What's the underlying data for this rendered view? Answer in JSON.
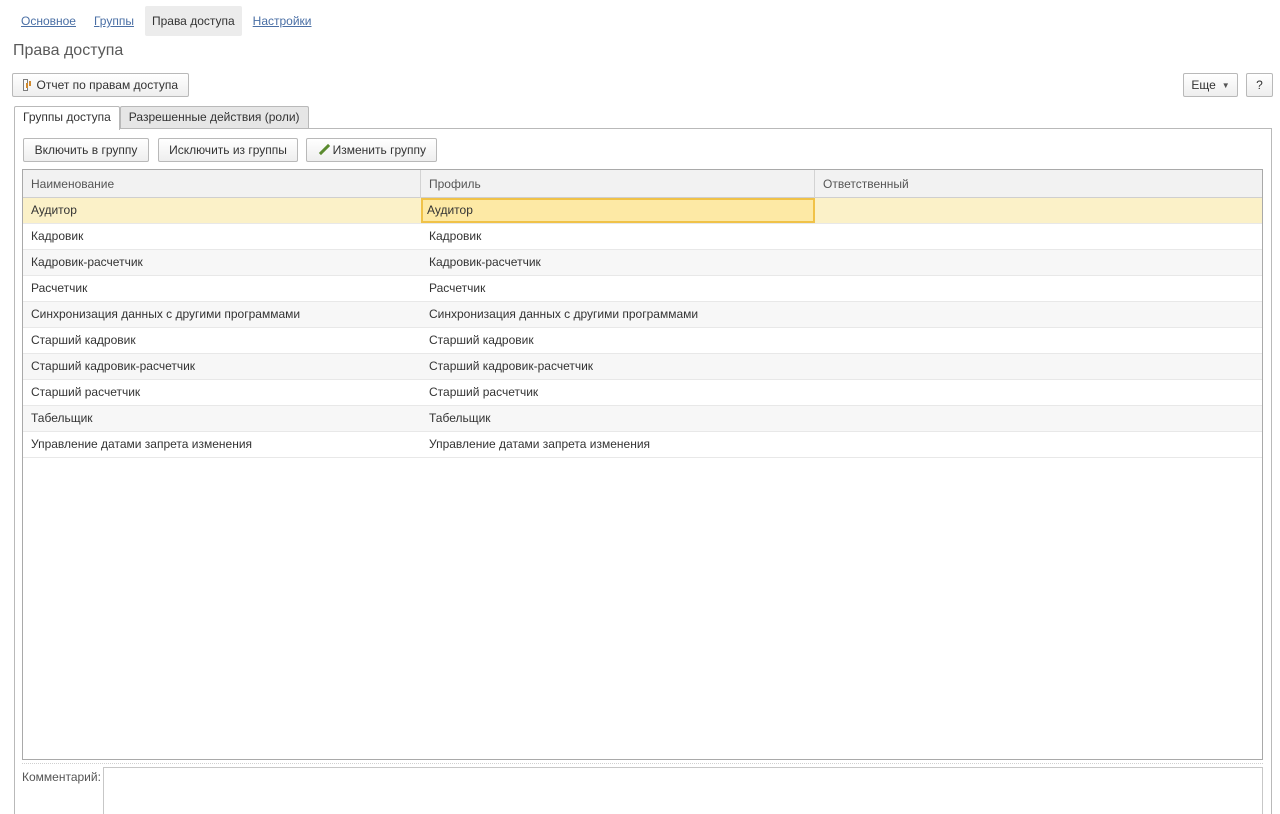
{
  "nav": {
    "items": [
      {
        "label": "Основное"
      },
      {
        "label": "Группы"
      },
      {
        "label": "Права доступа"
      },
      {
        "label": "Настройки"
      }
    ]
  },
  "page": {
    "title": "Права доступа"
  },
  "toolbar": {
    "report_label": "Отчет по правам доступа",
    "more_label": "Еще",
    "help_label": "?"
  },
  "tabs": [
    {
      "label": "Группы доступа"
    },
    {
      "label": "Разрешенные действия (роли)"
    }
  ],
  "actions": {
    "include_label": "Включить в группу",
    "exclude_label": "Исключить из группы",
    "edit_label": "Изменить группу"
  },
  "table": {
    "columns": [
      "Наименование",
      "Профиль",
      "Ответственный"
    ],
    "rows": [
      {
        "name": "Аудитор",
        "profile": "Аудитор",
        "responsible": ""
      },
      {
        "name": "Кадровик",
        "profile": "Кадровик",
        "responsible": ""
      },
      {
        "name": "Кадровик-расчетчик",
        "profile": "Кадровик-расчетчик",
        "responsible": ""
      },
      {
        "name": "Расчетчик",
        "profile": "Расчетчик",
        "responsible": ""
      },
      {
        "name": "Синхронизация данных с другими программами",
        "profile": "Синхронизация данных с другими программами",
        "responsible": ""
      },
      {
        "name": "Старший кадровик",
        "profile": "Старший кадровик",
        "responsible": ""
      },
      {
        "name": "Старший кадровик-расчетчик",
        "profile": "Старший кадровик-расчетчик",
        "responsible": ""
      },
      {
        "name": "Старший расчетчик",
        "profile": "Старший расчетчик",
        "responsible": ""
      },
      {
        "name": "Табельщик",
        "profile": "Табельщик",
        "responsible": ""
      },
      {
        "name": "Управление датами запрета изменения",
        "profile": "Управление датами запрета изменения",
        "responsible": ""
      }
    ]
  },
  "comment": {
    "label": "Комментарий:",
    "value": ""
  },
  "colors": {
    "link": "#4a6fa5",
    "selection": "#fbf1c8",
    "selection_border": "#f0c248"
  }
}
